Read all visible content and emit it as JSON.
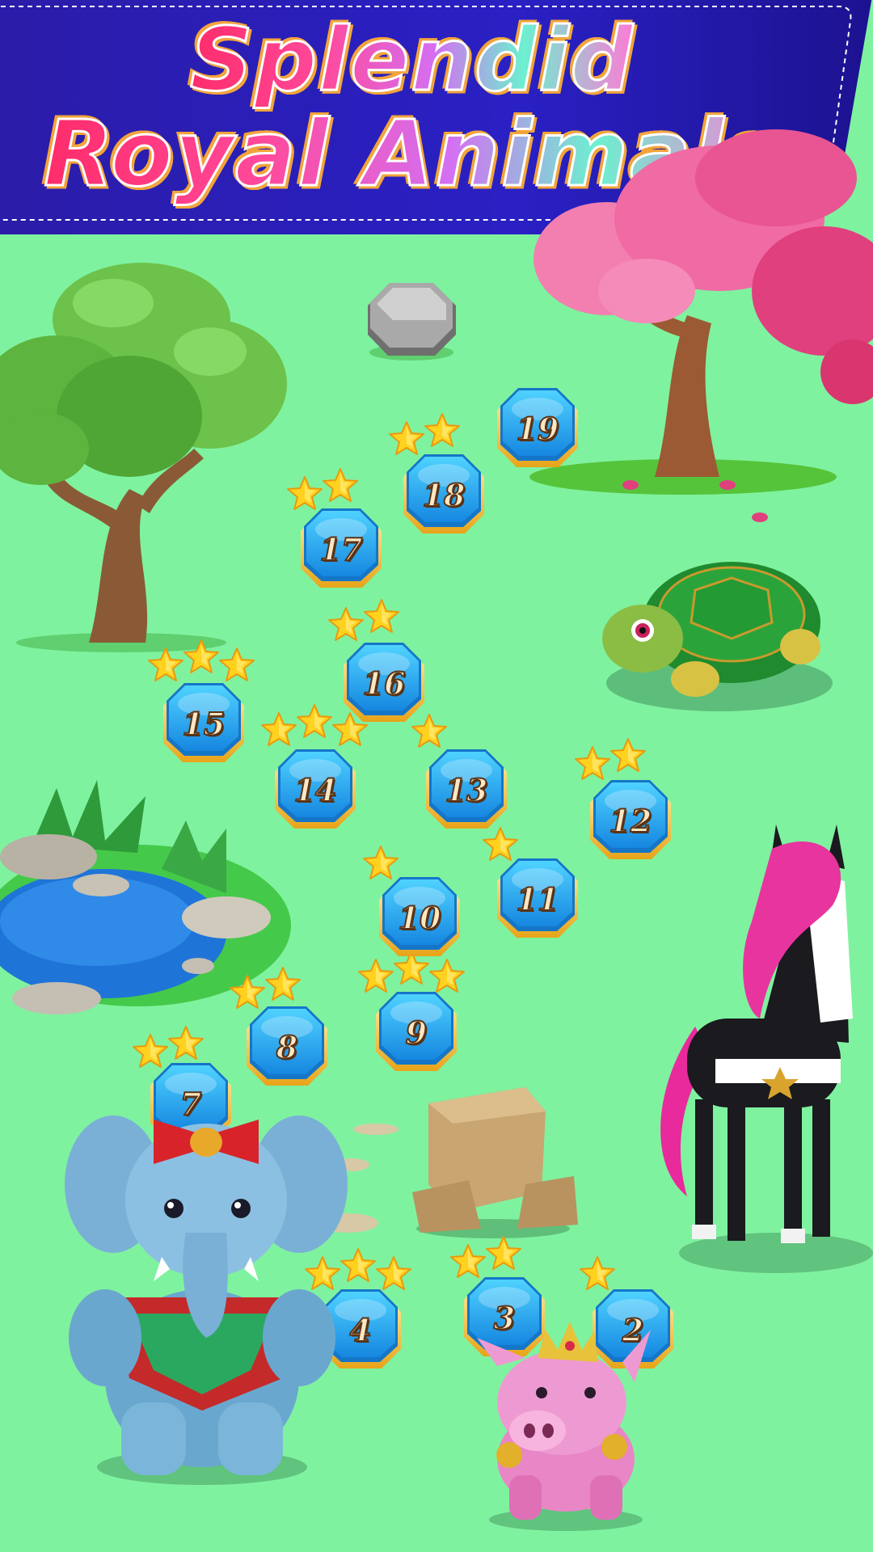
{
  "title": {
    "line1": "Splendid",
    "line2": "Royal Animals"
  },
  "colors": {
    "background": "#7ff29f",
    "banner": "#2a1aa8",
    "level_button": "#1da9ee",
    "level_rim": "#f2c24a",
    "star": "#ffd21f",
    "locked_button": "#8a8a8a"
  },
  "map": {
    "locked_node": {
      "state": "locked",
      "icon": "locked-level-icon"
    },
    "levels": [
      {
        "label": "2",
        "stars": 1
      },
      {
        "label": "3",
        "stars": 2
      },
      {
        "label": "4",
        "stars": 3
      },
      {
        "label": "7",
        "stars": 2
      },
      {
        "label": "8",
        "stars": 2
      },
      {
        "label": "9",
        "stars": 3
      },
      {
        "label": "10",
        "stars": 1
      },
      {
        "label": "11",
        "stars": 1
      },
      {
        "label": "12",
        "stars": 2
      },
      {
        "label": "13",
        "stars": 1
      },
      {
        "label": "14",
        "stars": 3
      },
      {
        "label": "15",
        "stars": 3
      },
      {
        "label": "16",
        "stars": 2
      },
      {
        "label": "17",
        "stars": 2
      },
      {
        "label": "18",
        "stars": 2
      },
      {
        "label": "19",
        "stars": 0
      }
    ]
  },
  "decorations": [
    "green-tree-icon",
    "pink-tree-icon",
    "turtle-icon",
    "pond-icon",
    "horse-icon",
    "rock-block-icon",
    "elephant-icon",
    "pig-icon"
  ]
}
